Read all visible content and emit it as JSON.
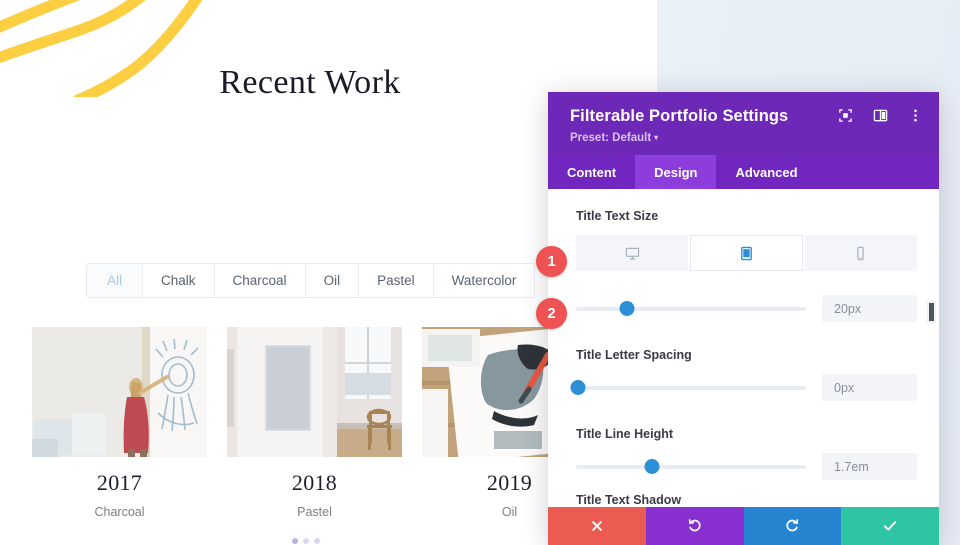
{
  "site": {
    "title": "Recent Work",
    "filters": [
      {
        "label": "All",
        "active": true
      },
      {
        "label": "Chalk",
        "active": false
      },
      {
        "label": "Charcoal",
        "active": false
      },
      {
        "label": "Oil",
        "active": false
      },
      {
        "label": "Pastel",
        "active": false
      },
      {
        "label": "Watercolor",
        "active": false
      }
    ],
    "portfolio": [
      {
        "year": "2017",
        "category": "Charcoal",
        "image": "woman-painting-wall-mural"
      },
      {
        "year": "2018",
        "category": "Pastel",
        "image": "gallery-room-canvas-chair"
      },
      {
        "year": "2019",
        "category": "Oil",
        "image": "hand-painting-with-brush"
      }
    ],
    "decoration": "yellow-brush-strokes",
    "accent_yellow": "#fbcf41"
  },
  "panel": {
    "title": "Filterable Portfolio Settings",
    "preset_label": "Preset: Default",
    "preset_caret": "▾",
    "header_icons": [
      {
        "name": "focus-target-icon"
      },
      {
        "name": "layout-columns-icon"
      },
      {
        "name": "more-vertical-icon"
      }
    ],
    "tabs": [
      {
        "label": "Content",
        "active": false
      },
      {
        "label": "Design",
        "active": true
      },
      {
        "label": "Advanced",
        "active": false
      }
    ],
    "header_bg": "#6d28b8",
    "tabs_bg": "#7226c0",
    "tab_active_bg": "#8c3ddb",
    "fields": {
      "title_text_size": {
        "label": "Title Text Size",
        "devices": [
          {
            "name": "desktop-icon",
            "active": false
          },
          {
            "name": "tablet-icon",
            "active": true
          },
          {
            "name": "phone-icon",
            "active": false
          }
        ],
        "value": "20px",
        "knob_percent": 22
      },
      "title_letter_spacing": {
        "label": "Title Letter Spacing",
        "value": "0px",
        "knob_percent": 1
      },
      "title_line_height": {
        "label": "Title Line Height",
        "value": "1.7em",
        "knob_percent": 33
      },
      "title_text_shadow": {
        "label": "Title Text Shadow"
      }
    },
    "actions": [
      {
        "name": "close-button",
        "icon": "x",
        "color": "#ec5b52"
      },
      {
        "name": "undo-button",
        "icon": "undo",
        "color": "#8830cf"
      },
      {
        "name": "redo-button",
        "icon": "redo",
        "color": "#2684d0"
      },
      {
        "name": "save-button",
        "icon": "check",
        "color": "#2fc4a3"
      }
    ]
  },
  "callouts": [
    {
      "number": "1"
    },
    {
      "number": "2"
    }
  ]
}
